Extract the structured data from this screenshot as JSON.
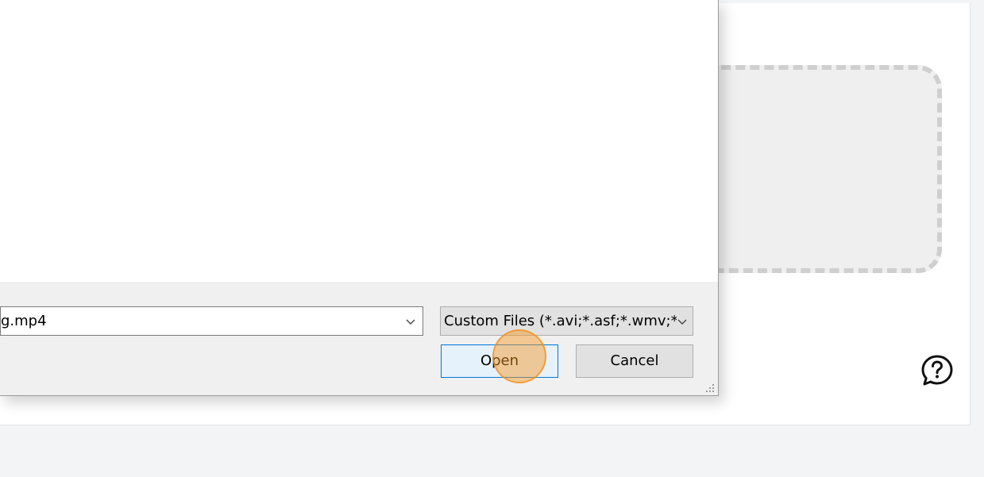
{
  "dialog": {
    "filename_value": "g.mp4",
    "filetype_selected": "Custom Files (*.avi;*.asf;*.wmv;*",
    "open_label": "Open",
    "cancel_label": "Cancel"
  },
  "icons": {
    "filename_dropdown": "chevron-down-icon",
    "filetype_dropdown": "chevron-down-icon",
    "help": "question-chat-bubble-icon",
    "resize": "resize-grip-icon"
  },
  "colors": {
    "open_button_border": "#0078d7",
    "click_highlight": "#f7941d"
  }
}
